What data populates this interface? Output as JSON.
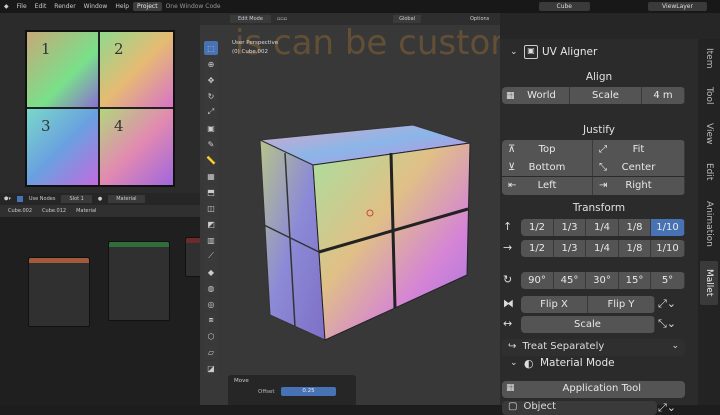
{
  "topbar": {
    "menus": [
      "File",
      "Edit",
      "Render",
      "Window",
      "Help"
    ],
    "tabs": [
      "Project",
      "One Window Code"
    ],
    "scene": "Cube",
    "viewlayer": "ViewLayer"
  },
  "uv_quads": [
    "1",
    "2",
    "3",
    "4"
  ],
  "node_header": {
    "use_nodes": "Use Nodes",
    "slot": "Slot 1",
    "material": "Material"
  },
  "node_breadcrumb": {
    "a": "Cube.002",
    "b": "Cube.012",
    "c": "Material"
  },
  "viewport": {
    "mode": "Edit Mode",
    "transform": "Global",
    "options": "Options",
    "info_line1": "User Perspective",
    "info_line2": "(0) Cube.002",
    "bg_text": "is can be customized"
  },
  "move_panel": {
    "title": "Move",
    "offset_label": "Offset",
    "offset_value": "0.25"
  },
  "npanel": {
    "title": "UV Aligner",
    "align": {
      "heading": "Align",
      "space": "World",
      "scale": "Scale",
      "scale_value": "4 m"
    },
    "justify": {
      "heading": "Justify",
      "top": "Top",
      "fit": "Fit",
      "bottom": "Bottom",
      "center": "Center",
      "left": "Left",
      "right": "Right"
    },
    "transform": {
      "heading": "Transform",
      "row1": [
        "1/2",
        "1/3",
        "1/4",
        "1/8",
        "1/10"
      ],
      "row2": [
        "1/2",
        "1/3",
        "1/4",
        "1/8",
        "1/10"
      ],
      "angles": [
        "90°",
        "45°",
        "30°",
        "15°",
        "5°"
      ],
      "flip_x": "Flip X",
      "flip_y": "Flip Y",
      "scale": "Scale"
    },
    "treat": "Treat Separately",
    "material_mode": "Material Mode",
    "application_tool": "Application Tool",
    "object": "Object"
  },
  "vtabs": [
    "Item",
    "Tool",
    "View",
    "Edit",
    "Animation",
    "Mallet"
  ],
  "colors": {
    "accent": "#4772b3",
    "button": "#545454",
    "panel": "#2b2b2b"
  }
}
